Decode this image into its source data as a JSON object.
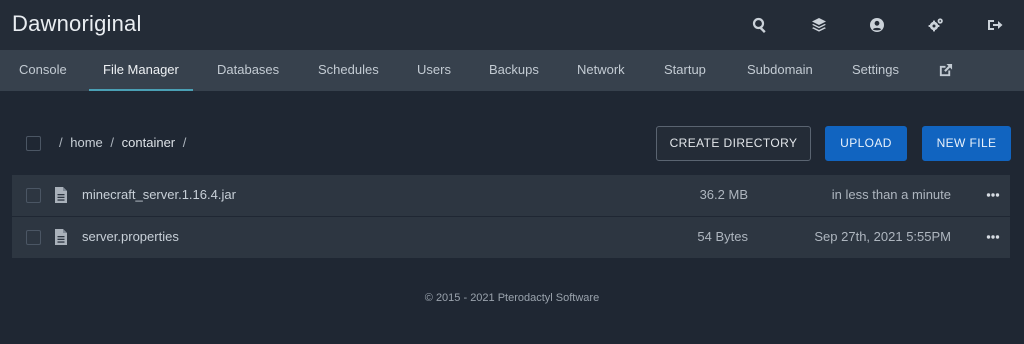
{
  "header": {
    "brand": "Dawnoriginal",
    "icons": [
      "search-icon",
      "layers-icon",
      "user-circle-icon",
      "cogs-icon",
      "sign-out-icon"
    ]
  },
  "nav": {
    "tabs": [
      {
        "label": "Console"
      },
      {
        "label": "File Manager",
        "active": true
      },
      {
        "label": "Databases"
      },
      {
        "label": "Schedules"
      },
      {
        "label": "Users"
      },
      {
        "label": "Backups"
      },
      {
        "label": "Network"
      },
      {
        "label": "Startup"
      },
      {
        "label": "Subdomain"
      },
      {
        "label": "Settings"
      }
    ],
    "external_icon": "external-link-icon"
  },
  "toolbar": {
    "breadcrumb": {
      "sep": "/",
      "segments": [
        "home",
        "container"
      ]
    },
    "create_directory_label": "CREATE DIRECTORY",
    "upload_label": "UPLOAD",
    "new_file_label": "NEW FILE"
  },
  "files": [
    {
      "name": "minecraft_server.1.16.4.jar",
      "size": "36.2 MB",
      "modified": "in less than a minute"
    },
    {
      "name": "server.properties",
      "size": "54 Bytes",
      "modified": "Sep 27th, 2021 5:55PM"
    }
  ],
  "footer": {
    "text": "© 2015 - 2021 Pterodactyl Software"
  },
  "colors": {
    "background": "#1f2733",
    "header": "#242c37",
    "subnav": "#37414d",
    "row": "#2d3641",
    "primary": "#1164c0",
    "active_tab_underline": "#4aa0b5"
  }
}
